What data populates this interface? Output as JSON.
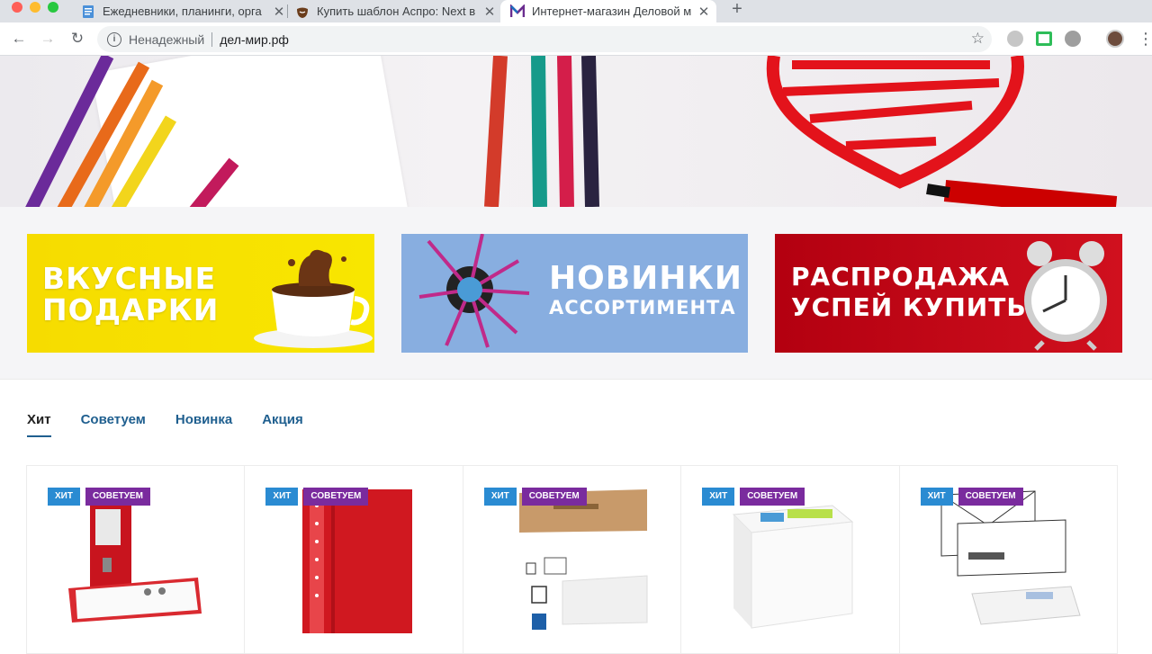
{
  "browser": {
    "tabs": [
      {
        "title": "Ежедневники, планинги, орга",
        "active": false,
        "icon": "doc-icon"
      },
      {
        "title": "Купить шаблон Аспро: Next в",
        "active": false,
        "icon": "beard-icon"
      },
      {
        "title": "Интернет-магазин Деловой м",
        "active": true,
        "icon": "m-logo-icon"
      }
    ],
    "new_tab": "+",
    "omnibox": {
      "security": "Ненадежный",
      "url": "дел-мир.рф"
    }
  },
  "hero": {
    "slides": 4,
    "active_slide": 1
  },
  "promos": [
    {
      "lines": [
        "Вкусные",
        "подарки"
      ]
    },
    {
      "lines": [
        "Новинки",
        "ассортимента"
      ]
    },
    {
      "lines": [
        "Распродажа",
        "успей купить!"
      ]
    }
  ],
  "product_tabs": [
    "Хит",
    "Советуем",
    "Новинка",
    "Акция"
  ],
  "active_product_tab": "Хит",
  "products": [
    {
      "badges": [
        "хит",
        "советуем"
      ],
      "item": "red-binder"
    },
    {
      "badges": [
        "хит",
        "советуем"
      ],
      "item": "red-folder"
    },
    {
      "badges": [
        "хит",
        "советуем"
      ],
      "item": "paper-towels"
    },
    {
      "badges": [
        "хит",
        "советуем"
      ],
      "item": "note-block"
    },
    {
      "badges": [
        "хит",
        "советуем"
      ],
      "item": "envelopes"
    }
  ],
  "colors": {
    "badge_hit": "#2a8bd2",
    "badge_rec": "#7a2b9e",
    "tab_link": "#1f5f8f"
  }
}
